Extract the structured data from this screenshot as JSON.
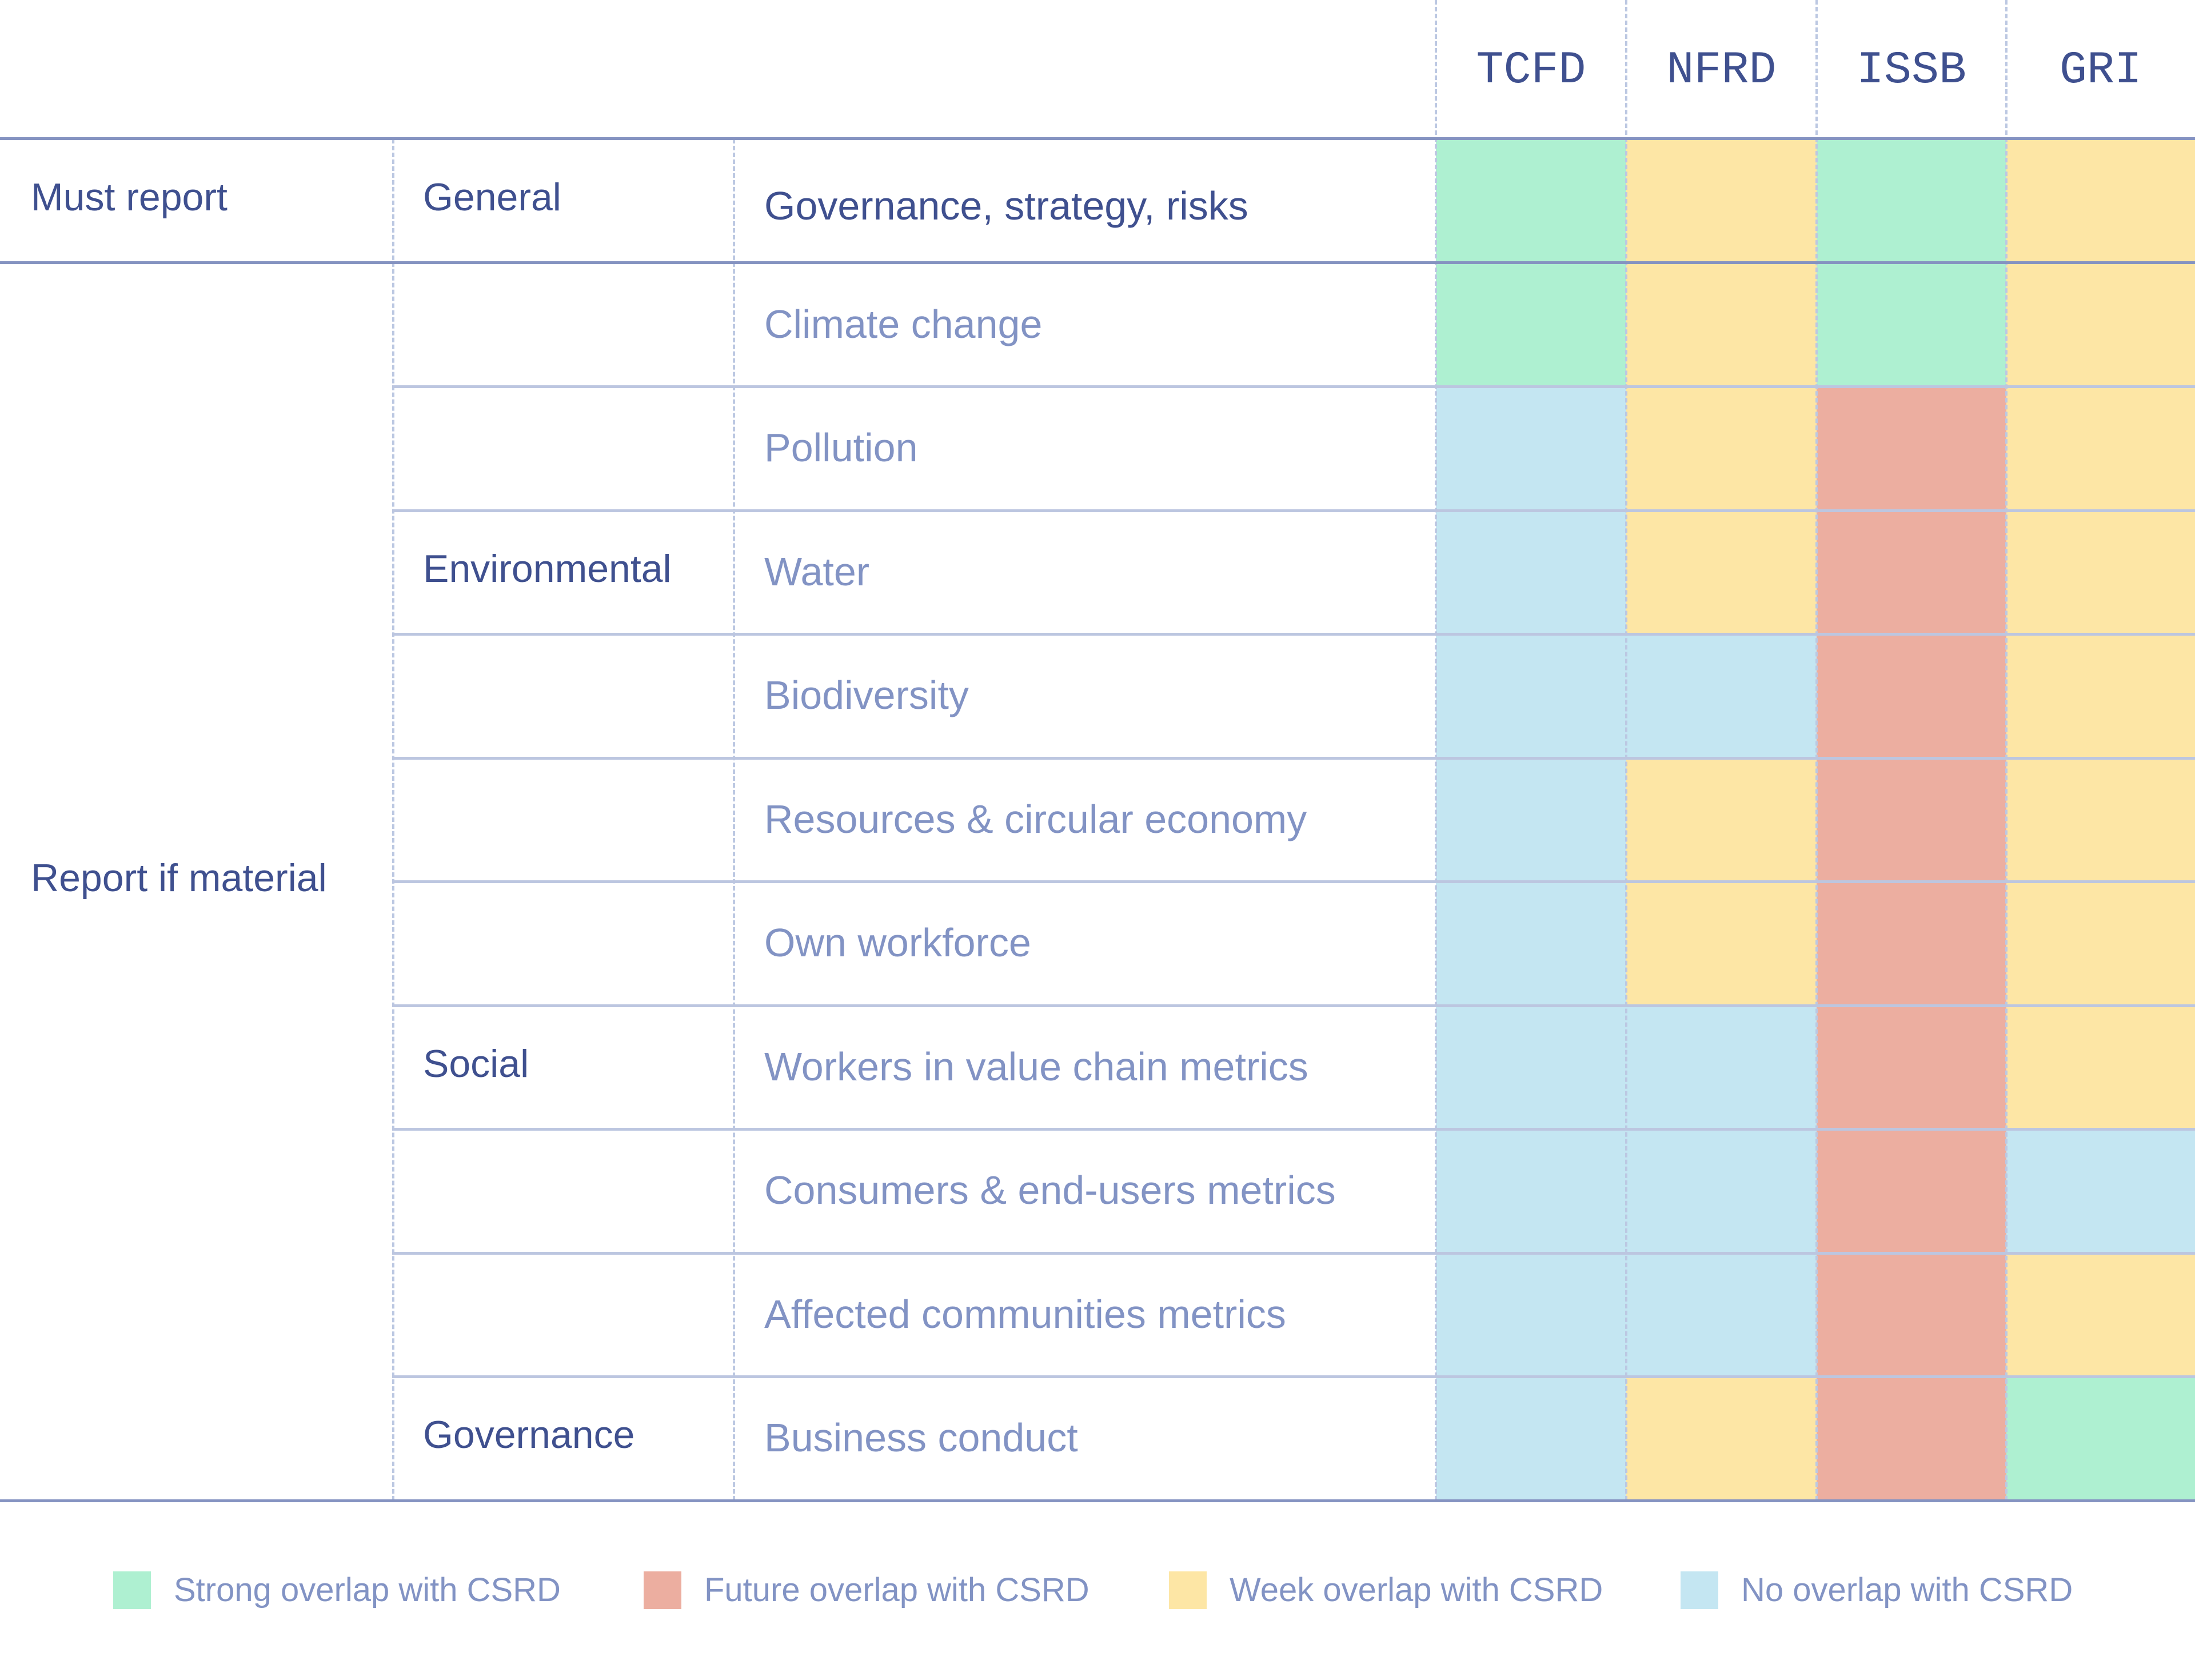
{
  "chart_data": {
    "type": "heatmap",
    "title": "",
    "columns": [
      "TCFD",
      "NFRD",
      "ISSB",
      "GRI"
    ],
    "rows": [
      {
        "requirement": "Must report",
        "category": "General",
        "topic": "Governance, strategy, risks",
        "values": [
          "strong",
          "weak",
          "strong",
          "weak"
        ]
      },
      {
        "requirement": "Report if material",
        "category": "Environmental",
        "topic": "Climate change",
        "values": [
          "strong",
          "weak",
          "strong",
          "weak"
        ]
      },
      {
        "requirement": "Report if material",
        "category": "Environmental",
        "topic": "Pollution",
        "values": [
          "none",
          "weak",
          "future",
          "weak"
        ]
      },
      {
        "requirement": "Report if material",
        "category": "Environmental",
        "topic": "Water",
        "values": [
          "none",
          "weak",
          "future",
          "weak"
        ]
      },
      {
        "requirement": "Report if material",
        "category": "Environmental",
        "topic": "Biodiversity",
        "values": [
          "none",
          "none",
          "future",
          "weak"
        ]
      },
      {
        "requirement": "Report if material",
        "category": "Environmental",
        "topic": "Resources & circular economy",
        "values": [
          "none",
          "weak",
          "future",
          "weak"
        ]
      },
      {
        "requirement": "Report if material",
        "category": "Social",
        "topic": "Own workforce",
        "values": [
          "none",
          "weak",
          "future",
          "weak"
        ]
      },
      {
        "requirement": "Report if material",
        "category": "Social",
        "topic": "Workers in value chain metrics",
        "values": [
          "none",
          "none",
          "future",
          "weak"
        ]
      },
      {
        "requirement": "Report if material",
        "category": "Social",
        "topic": "Consumers & end-users metrics",
        "values": [
          "none",
          "none",
          "future",
          "none"
        ]
      },
      {
        "requirement": "Report if material",
        "category": "Social",
        "topic": "Affected communities metrics",
        "values": [
          "none",
          "none",
          "future",
          "weak"
        ]
      },
      {
        "requirement": "Report if material",
        "category": "Governance",
        "topic": "Business conduct",
        "values": [
          "none",
          "weak",
          "future",
          "strong"
        ]
      }
    ],
    "requirement_groups": [
      {
        "label": "Must report",
        "rows": [
          0
        ]
      },
      {
        "label": "Report if material",
        "rows": [
          1,
          2,
          3,
          4,
          5,
          6,
          7,
          8,
          9,
          10
        ]
      }
    ],
    "category_groups": [
      {
        "label": "General",
        "rows": [
          0
        ]
      },
      {
        "label": "Environmental",
        "rows": [
          1,
          2,
          3,
          4,
          5
        ]
      },
      {
        "label": "Social",
        "rows": [
          6,
          7,
          8,
          9
        ]
      },
      {
        "label": "Governance",
        "rows": [
          10
        ]
      }
    ],
    "legend": [
      {
        "key": "strong",
        "label": "Strong overlap with CSRD",
        "color": "#aef0d1"
      },
      {
        "key": "future",
        "label": "Future overlap with CSRD",
        "color": "#ecaea0"
      },
      {
        "key": "weak",
        "label": "Week overlap with CSRD",
        "color": "#fde6a5"
      },
      {
        "key": "none",
        "label": "No overlap with CSRD",
        "color": "#c4e6f2"
      }
    ],
    "legend_position": "bottom"
  },
  "colors": {
    "text_dark": "#3f508f",
    "text_light": "#8293c4",
    "line_strong": "#8593c1",
    "line_light": "#bcc6e0"
  }
}
